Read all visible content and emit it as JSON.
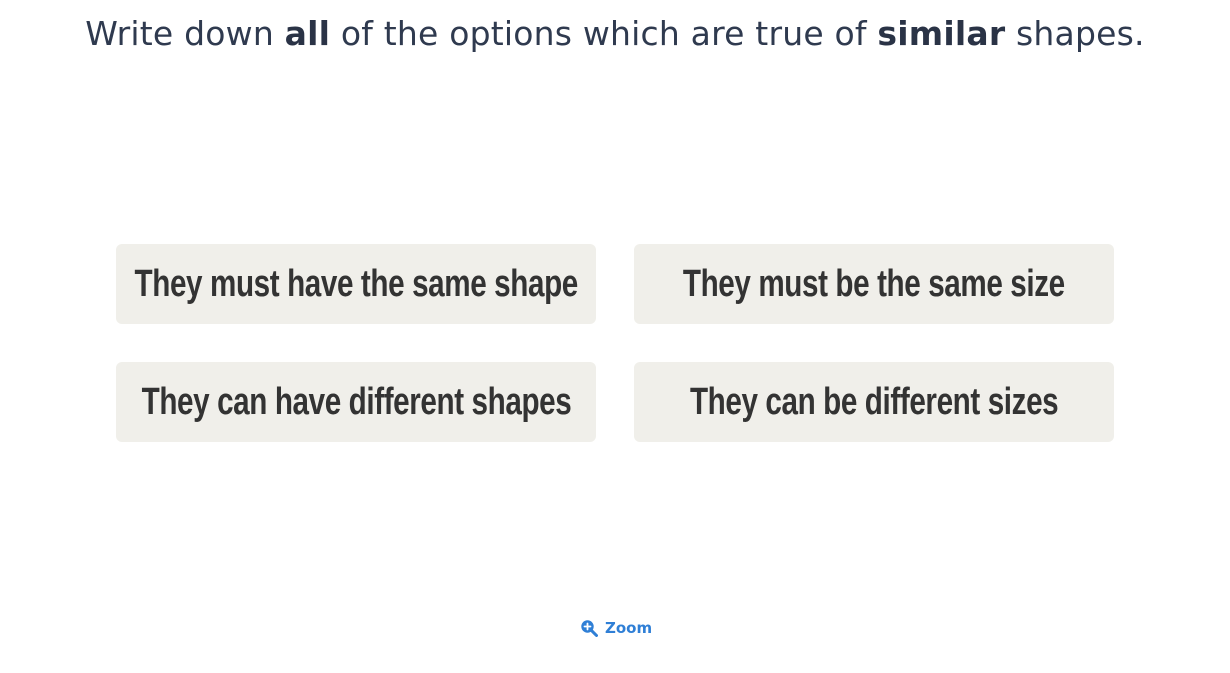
{
  "question": {
    "part1": "Write down ",
    "bold1": "all",
    "part2": " of the options which are true of ",
    "bold2": "similar",
    "part3": " shapes."
  },
  "options": [
    {
      "label": "They must have the same shape"
    },
    {
      "label": "They must be the same size"
    },
    {
      "label": "They can have different shapes"
    },
    {
      "label": "They can be different sizes"
    }
  ],
  "zoom": {
    "label": "Zoom",
    "icon": "zoom-in-icon"
  },
  "colors": {
    "text": "#2f3a4f",
    "option_bg": "#f0efea",
    "option_text": "#333333",
    "link": "#2f7fd6"
  }
}
